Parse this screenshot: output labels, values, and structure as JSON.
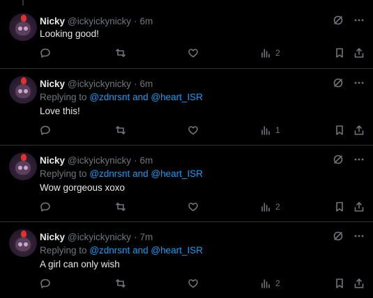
{
  "author": {
    "name": "Nicky",
    "handle": "@ickyickynicky",
    "separator": "·"
  },
  "reply_prefix": "Replying to",
  "reply_and": "and",
  "tweets": [
    {
      "time": "6m",
      "text": "Looking good!",
      "replying": false,
      "views": "2"
    },
    {
      "time": "6m",
      "text": "Love this!",
      "replying": true,
      "mentions": [
        "@zdnrsnt",
        "@heart_ISR"
      ],
      "views": "1"
    },
    {
      "time": "6m",
      "text": "Wow gorgeous xoxo",
      "replying": true,
      "mentions": [
        "@zdnrsnt",
        "@heart_ISR"
      ],
      "views": "2"
    },
    {
      "time": "7m",
      "text": "A girl can only wish",
      "replying": true,
      "mentions": [
        "@zdnrsnt",
        "@heart_ISR"
      ],
      "views": "2"
    }
  ],
  "icons": {
    "grok": "grok-icon",
    "more": "more-icon",
    "reply": "reply-icon",
    "retweet": "retweet-icon",
    "like": "heart-icon",
    "views": "views-icon",
    "bookmark": "bookmark-icon",
    "share": "share-icon"
  },
  "colors": {
    "background": "#000000",
    "text": "#e7e9ea",
    "muted": "#71767b",
    "link": "#1d9bf0",
    "divider": "#2f3336"
  }
}
